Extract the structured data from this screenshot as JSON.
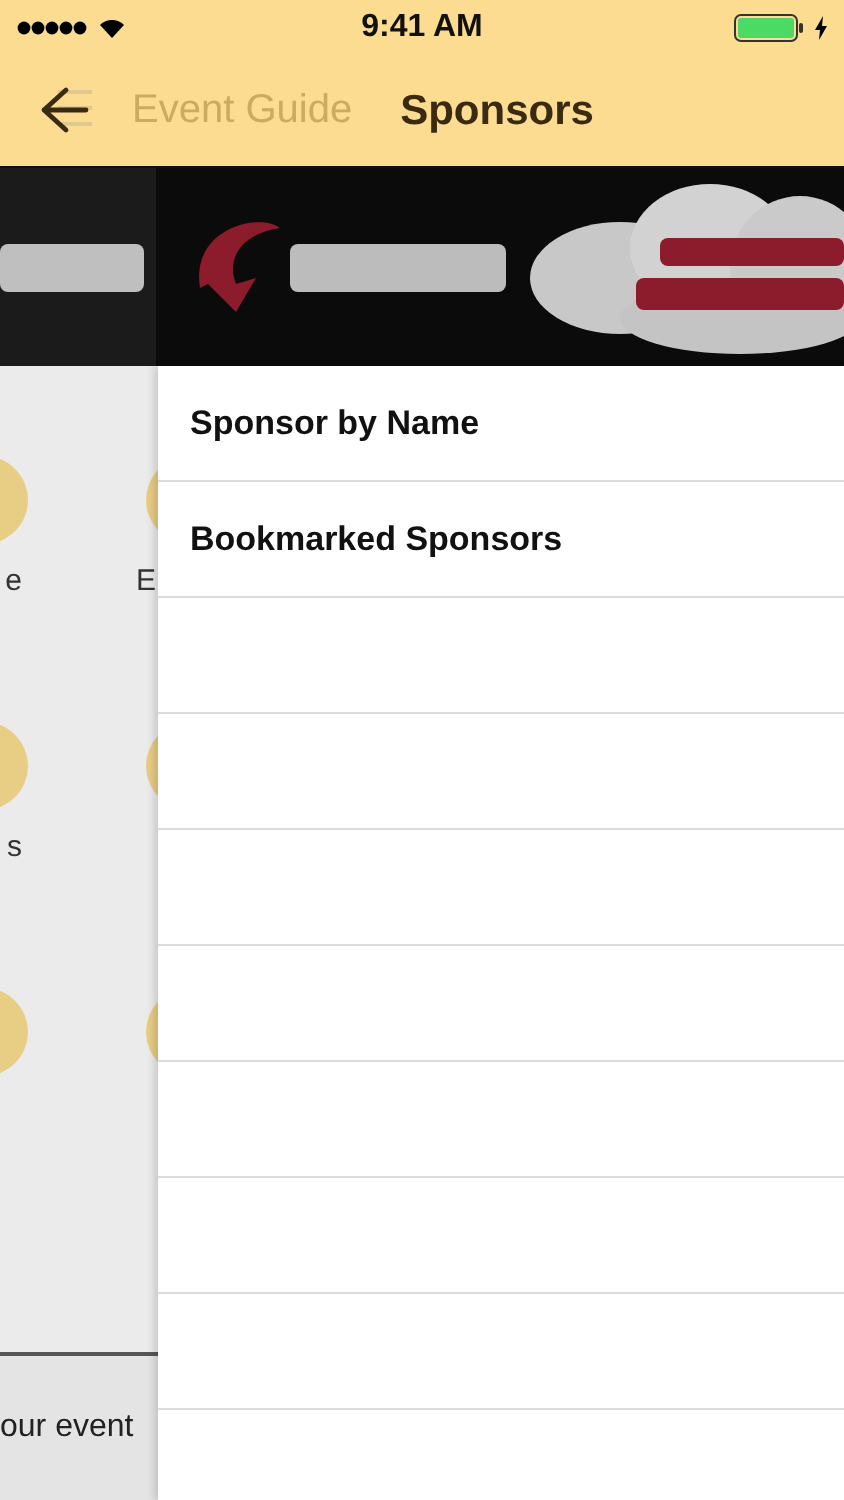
{
  "status_bar": {
    "time": "9:41 AM"
  },
  "nav": {
    "back_label": "Event Guide",
    "title": "Sponsors"
  },
  "background_menu": {
    "rows": [
      {
        "tiles": [
          {
            "kind": "tile",
            "label": "e"
          },
          {
            "kind": "tile",
            "label": "E"
          }
        ]
      },
      {
        "tiles": [
          {
            "kind": "tile",
            "label": "s"
          },
          {
            "kind": "tile"
          }
        ]
      },
      {
        "tiles": [
          {
            "kind": "tile"
          },
          {
            "kind": "tile"
          }
        ]
      }
    ],
    "footer_text": "our event"
  },
  "menu": {
    "items": [
      {
        "label": "Sponsor by Name"
      },
      {
        "label": "Bookmarked Sponsors"
      }
    ]
  }
}
